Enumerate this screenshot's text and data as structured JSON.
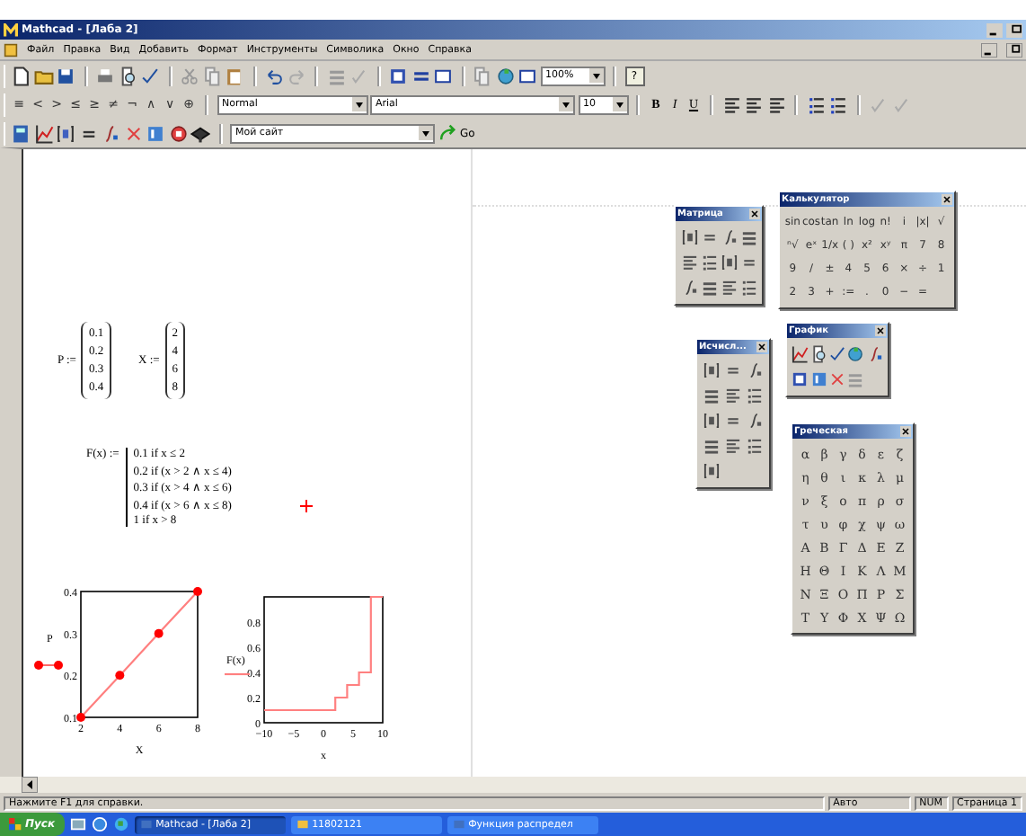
{
  "window": {
    "title": "Mathcad - [Лаба 2]"
  },
  "menu": [
    "Файл",
    "Правка",
    "Вид",
    "Добавить",
    "Формат",
    "Инструменты",
    "Символика",
    "Окно",
    "Справка"
  ],
  "toolbar": {
    "zoom": "100%",
    "help": "?",
    "operators": [
      "≡",
      "<",
      ">",
      "≤",
      "≥",
      "≠",
      "¬",
      "∧",
      "∨",
      "⊕"
    ],
    "style": "Normal",
    "font": "Arial",
    "size": "10",
    "bold": "B",
    "italic": "I",
    "underline": "U",
    "address": "Мой сайт",
    "go": "Go"
  },
  "worksheet": {
    "definitions": [
      {
        "label": "P :=",
        "values": [
          "0.1",
          "0.2",
          "0.3",
          "0.4"
        ]
      },
      {
        "label": "X :=",
        "values": [
          "2",
          "4",
          "6",
          "8"
        ]
      }
    ],
    "function": {
      "label": "F(x) :=",
      "cases": [
        "0.1  if  x ≤ 2",
        "0.2  if  (x > 2 ∧ x ≤ 4)",
        "0.3  if  (x > 4 ∧ x ≤ 6)",
        "0.4  if  (x > 6 ∧ x ≤ 8)",
        "1  if  x > 8"
      ]
    },
    "charts": [
      {
        "chart_data": {
          "type": "line",
          "xlabel": "X",
          "x": [
            2,
            4,
            6,
            8
          ],
          "series": [
            {
              "name": "P",
              "color": "#ff0000",
              "marker": "circle",
              "values": [
                0.1,
                0.2,
                0.3,
                0.4
              ]
            }
          ],
          "xlim": [
            2,
            8
          ],
          "ylim": [
            0.1,
            0.4
          ],
          "xticks": [
            2,
            4,
            6,
            8
          ],
          "yticks": [
            0.1,
            0.2,
            0.3,
            0.4
          ]
        }
      },
      {
        "chart_data": {
          "type": "line",
          "xlabel": "x",
          "x": [
            -10,
            2,
            2,
            4,
            4,
            6,
            6,
            8,
            8,
            10
          ],
          "series": [
            {
              "name": "F(x)",
              "color": "#ff8080",
              "values": [
                0.1,
                0.1,
                0.2,
                0.2,
                0.3,
                0.3,
                0.4,
                0.4,
                1,
                1
              ]
            }
          ],
          "xlim": [
            -10,
            10
          ],
          "ylim": [
            0,
            1
          ],
          "xticks": [
            {
              "value": -10,
              "label": "−10"
            },
            {
              "value": -5,
              "label": "−5"
            },
            0,
            5,
            10
          ],
          "yticks": [
            0,
            0.2,
            0.4,
            0.6,
            0.8
          ]
        }
      }
    ]
  },
  "palettes": [
    {
      "title": "Матрица",
      "kind": "icons"
    },
    {
      "title": "Калькулятор",
      "kind": "keys",
      "keys": [
        "sin",
        "cos",
        "tan",
        "ln",
        "log",
        "n!",
        "i",
        "|x|",
        "√",
        "ⁿ√",
        "eˣ",
        "1/x",
        "( )",
        "x²",
        "xʸ",
        "π",
        "7",
        "8",
        "9",
        "/",
        "±",
        "4",
        "5",
        "6",
        "×",
        "÷",
        "1",
        "2",
        "3",
        "+",
        ":=",
        ".",
        "0",
        "−",
        "="
      ]
    },
    {
      "title": "Исчисл...",
      "kind": "icons"
    },
    {
      "title": "График",
      "kind": "graph"
    },
    {
      "title": "Греческая",
      "kind": "keys",
      "keys": [
        "α",
        "β",
        "γ",
        "δ",
        "ε",
        "ζ",
        "η",
        "θ",
        "ι",
        "κ",
        "λ",
        "μ",
        "ν",
        "ξ",
        "ο",
        "π",
        "ρ",
        "σ",
        "τ",
        "υ",
        "φ",
        "χ",
        "ψ",
        "ω",
        "Α",
        "Β",
        "Γ",
        "Δ",
        "Ε",
        "Ζ",
        "Η",
        "Θ",
        "Ι",
        "Κ",
        "Λ",
        "Μ",
        "Ν",
        "Ξ",
        "Ο",
        "Π",
        "Ρ",
        "Σ",
        "Τ",
        "Υ",
        "Φ",
        "Χ",
        "Ψ",
        "Ω"
      ]
    }
  ],
  "status_bar": {
    "message": "Нажмите F1 для справки.",
    "mode": "Авто",
    "num": "NUM",
    "page": "Страница 1"
  },
  "taskbar": {
    "start": "Пуск",
    "tasks": [
      {
        "label": "Mathcad - [Лаба 2]",
        "selected": true
      },
      {
        "label": "11802121",
        "selected": false
      },
      {
        "label": "Функция распредел",
        "selected": false
      }
    ]
  }
}
